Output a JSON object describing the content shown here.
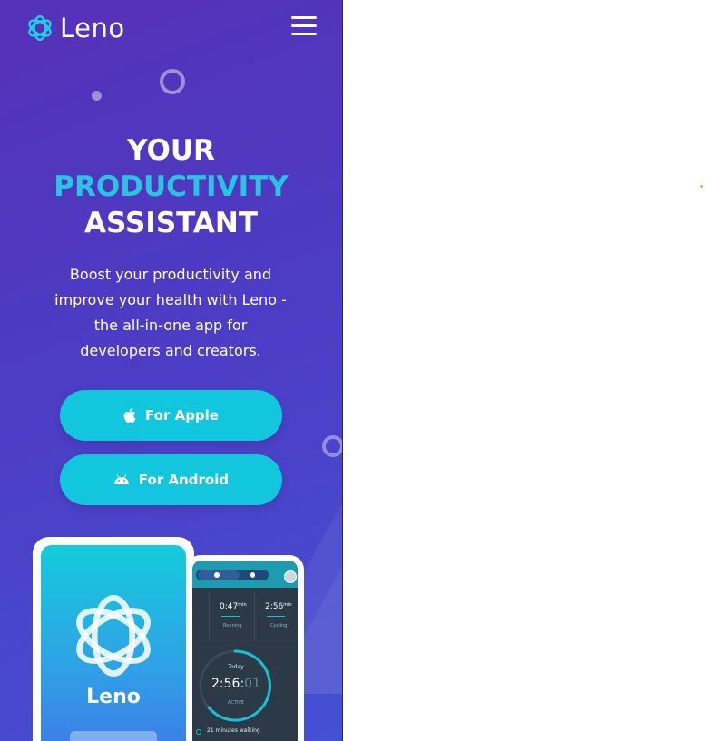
{
  "brand": {
    "name": "Leno"
  },
  "hero": {
    "headline": [
      "YOUR",
      "PRODUCTIVITY",
      "ASSISTANT"
    ],
    "description": "Boost your productivity and improve your health with Leno - the all-in-one app for developers and creators.",
    "buttons": {
      "apple": "For Apple",
      "android": "For Android"
    }
  },
  "phone_left": {
    "app_name": "Leno"
  },
  "phone_right": {
    "stats": [
      {
        "value": "0:47",
        "unit": "min",
        "label": "Running"
      },
      {
        "value": "2:56",
        "unit": "min",
        "label": "Cycling"
      }
    ],
    "gauge": {
      "label": "Today",
      "time_main": "2:56:",
      "time_dim": "01",
      "status": "ACTIVE"
    },
    "activity": "21 minutes walking"
  },
  "colors": {
    "accent": "#29c4e2",
    "button": "#12c6dd",
    "background": "#4d3cc4"
  }
}
